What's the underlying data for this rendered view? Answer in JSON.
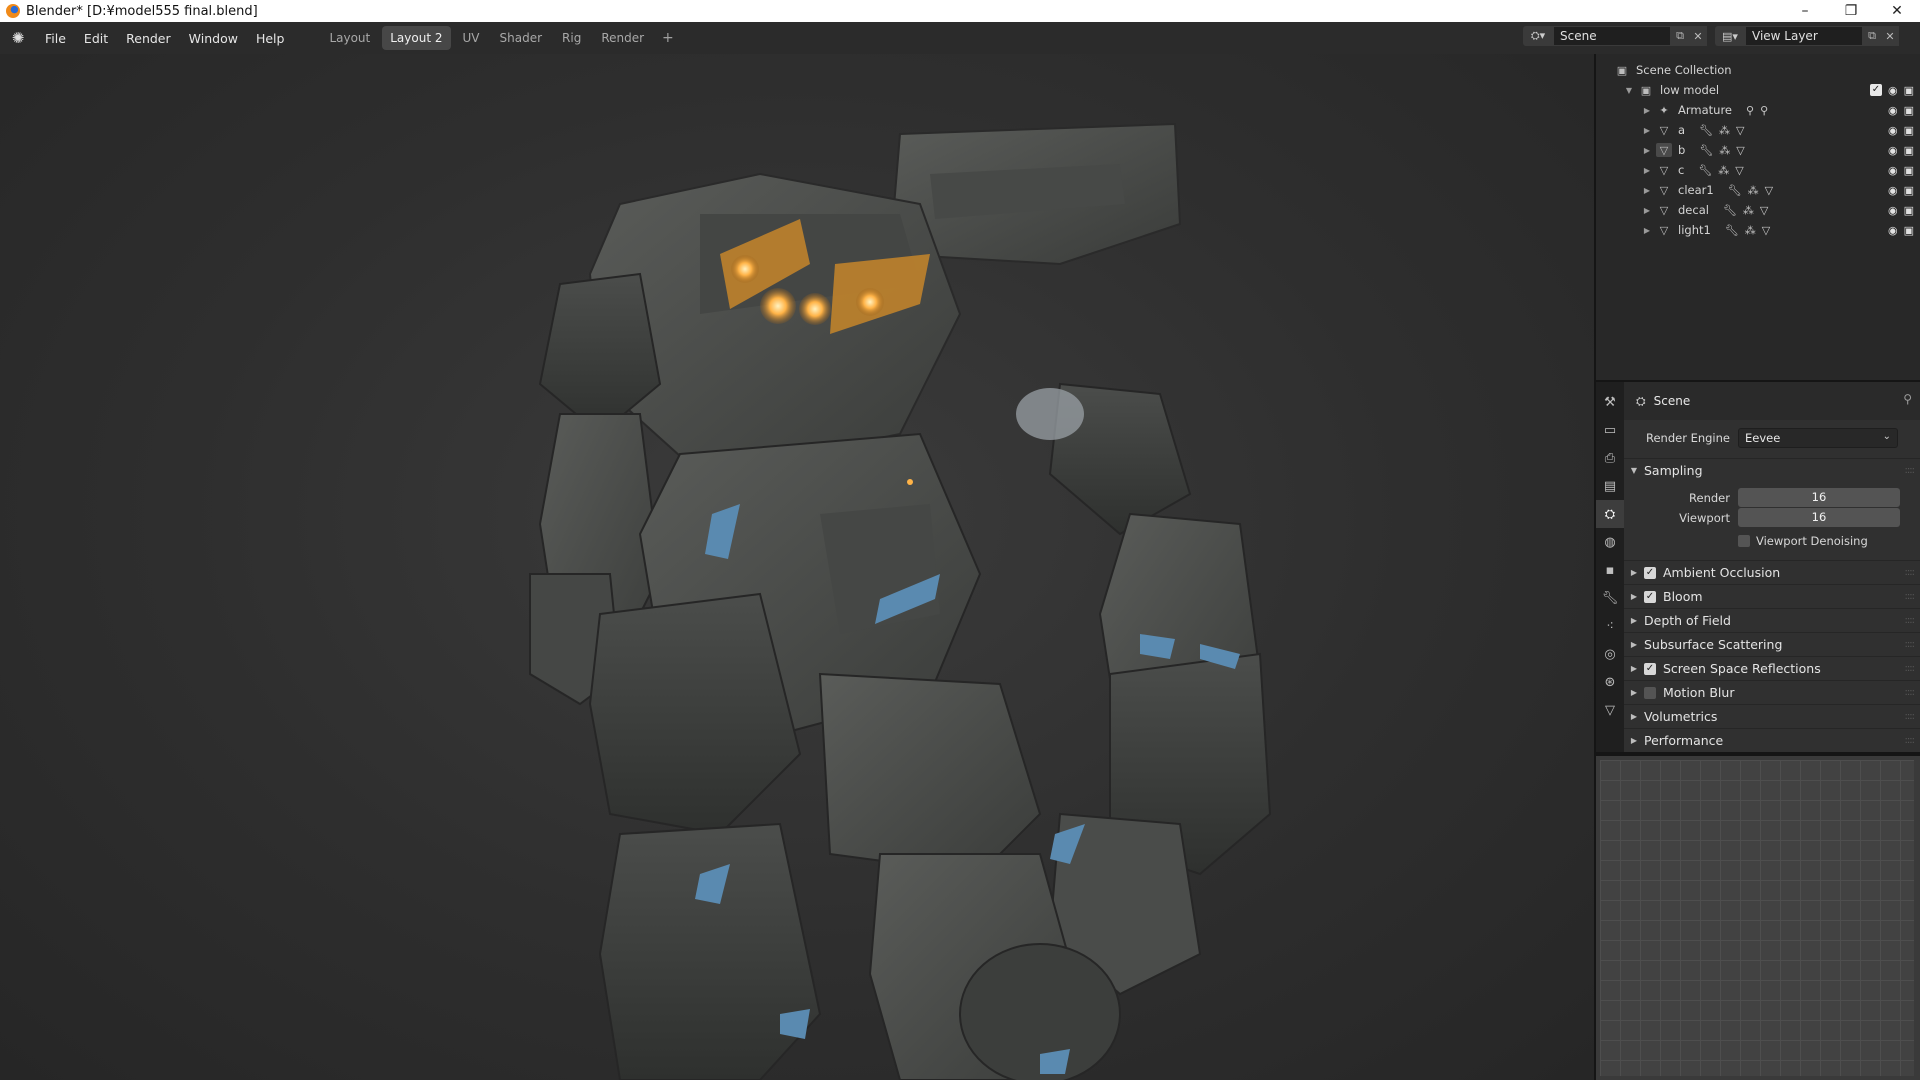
{
  "window": {
    "title": "Blender* [D:¥model555 final.blend]",
    "controls": [
      "–",
      "❐",
      "✕"
    ]
  },
  "menu": [
    "File",
    "Edit",
    "Render",
    "Window",
    "Help"
  ],
  "workspaces": {
    "tabs": [
      "Layout",
      "Layout 2",
      "UV",
      "Shader",
      "Rig",
      "Render"
    ],
    "active": "Layout 2",
    "add_label": "+"
  },
  "scene_selector": {
    "scene": "Scene",
    "view_layer": "View Layer"
  },
  "outliner": {
    "root": "Scene Collection",
    "collection": "low model",
    "items": [
      {
        "name": "Armature",
        "icon": "armature-icon"
      },
      {
        "name": "a",
        "icon": "mesh-icon"
      },
      {
        "name": "b",
        "icon": "mesh-icon"
      },
      {
        "name": "c",
        "icon": "mesh-icon"
      },
      {
        "name": "clear1",
        "icon": "mesh-icon"
      },
      {
        "name": "decal",
        "icon": "mesh-icon"
      },
      {
        "name": "light1",
        "icon": "mesh-icon"
      }
    ]
  },
  "properties": {
    "context": "Scene",
    "render_engine_label": "Render Engine",
    "render_engine": "Eevee",
    "sampling": {
      "title": "Sampling",
      "render_label": "Render",
      "render": "16",
      "viewport_label": "Viewport",
      "viewport": "16",
      "denoise_label": "Viewport Denoising"
    },
    "panels": [
      {
        "label": "Ambient Occlusion",
        "checkbox": true,
        "checked": true
      },
      {
        "label": "Bloom",
        "checkbox": true,
        "checked": true
      },
      {
        "label": "Depth of Field",
        "checkbox": false,
        "checked": false
      },
      {
        "label": "Subsurface Scattering",
        "checkbox": false,
        "checked": false
      },
      {
        "label": "Screen Space Reflections",
        "checkbox": true,
        "checked": true
      },
      {
        "label": "Motion Blur",
        "checkbox": true,
        "checked": false
      },
      {
        "label": "Volumetrics",
        "checkbox": false,
        "checked": false
      },
      {
        "label": "Performance",
        "checkbox": false,
        "checked": false
      }
    ]
  },
  "colors": {
    "accent_glow": "#ffb347",
    "armor": "#4a4c4a",
    "armor_blue": "#5a8ab0"
  }
}
